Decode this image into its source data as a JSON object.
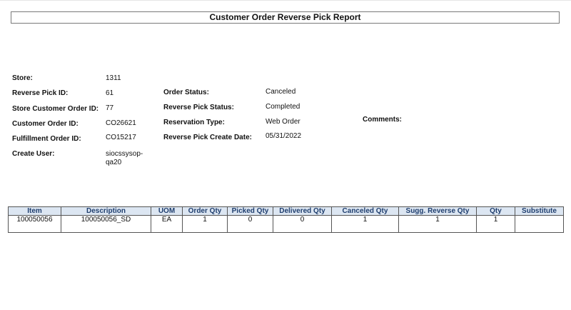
{
  "report_title": "Customer Order Reverse Pick Report",
  "fields": {
    "store_label": "Store:",
    "store_value": "1311",
    "reverse_pick_id_label": "Reverse Pick ID:",
    "reverse_pick_id_value": "61",
    "store_customer_order_id_label": "Store Customer Order ID:",
    "store_customer_order_id_value": "77",
    "customer_order_id_label": "Customer Order ID:",
    "customer_order_id_value": "CO26621",
    "fulfillment_order_id_label": "Fulfillment Order ID:",
    "fulfillment_order_id_value": "CO15217",
    "create_user_label": "Create User:",
    "create_user_value": "siocssysop-qa20",
    "order_status_label": "Order Status:",
    "order_status_value": "Canceled",
    "reverse_pick_status_label": "Reverse Pick Status:",
    "reverse_pick_status_value": "Completed",
    "reservation_type_label": "Reservation Type:",
    "reservation_type_value": "Web Order",
    "reverse_pick_create_date_label": "Reverse Pick Create Date:",
    "reverse_pick_create_date_value": "05/31/2022",
    "comments_label": "Comments:"
  },
  "table": {
    "headers": [
      "Item",
      "Description",
      "UOM",
      "Order Qty",
      "Picked Qty",
      "Delivered Qty",
      "Canceled Qty",
      "Sugg. Reverse Qty",
      "Qty",
      "Substitute"
    ],
    "rows": [
      [
        "100050056",
        "100050056_SD",
        "EA",
        "1",
        "0",
        "0",
        "1",
        "1",
        "1",
        ""
      ]
    ]
  },
  "colors": {
    "header_bg": "#dce6f2",
    "header_text": "#1f3e6e",
    "border": "#555555"
  }
}
